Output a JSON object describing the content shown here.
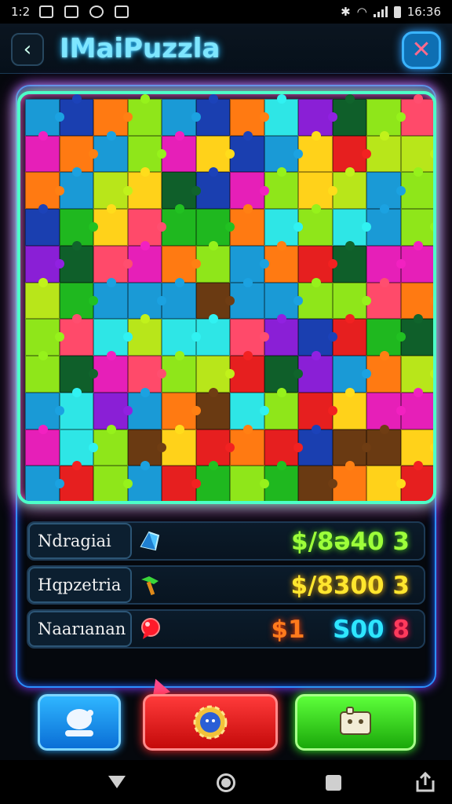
{
  "status_bar": {
    "time_left": "1:2",
    "time_right": "16:36"
  },
  "header": {
    "title": "IMaiPuzzla"
  },
  "stats": [
    {
      "label": "Ndragiai",
      "value": "$/8ǝ40 3",
      "icon": "blue-crystal-icon"
    },
    {
      "label": "Hqpzetria",
      "value": "$/8300 3",
      "icon": "green-pickaxe-icon"
    },
    {
      "label": "Naarıanan",
      "value_a": "$1",
      "value_b": "S00",
      "value_c": "8",
      "icon": "red-gem-icon"
    }
  ],
  "buttons": [
    {
      "name": "profile-button",
      "icon": "avatar-icon"
    },
    {
      "name": "settings-button",
      "icon": "gear-icon"
    },
    {
      "name": "gallery-button",
      "icon": "puzzle-card-icon"
    }
  ],
  "colors": {
    "accent_cyan": "#7ee6ff",
    "neon_green": "#4dffc8",
    "neon_pink": "#ff3bd9",
    "button_blue": "#0a6ed6",
    "button_red": "#c40a0a",
    "button_green": "#1aa80a"
  },
  "puzzle": {
    "columns": 12,
    "rows": 11,
    "palette": [
      "#e61f1f",
      "#ff7a12",
      "#ffd21a",
      "#8fe61a",
      "#1fb81f",
      "#0f5f2a",
      "#1a9ad6",
      "#1a3fb0",
      "#8a1fd6",
      "#e61fb8",
      "#ff4a6a",
      "#6a3a12",
      "#2ee6e6",
      "#b8e61a"
    ]
  }
}
